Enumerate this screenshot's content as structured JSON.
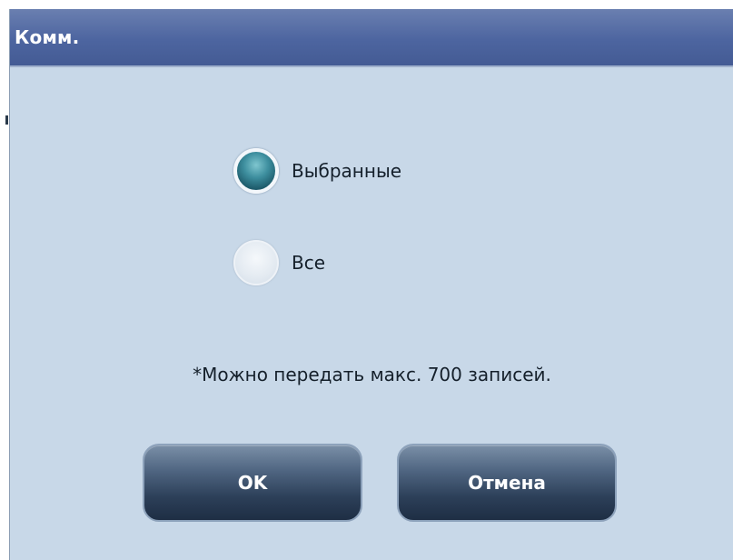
{
  "dialog": {
    "title": "Комм.",
    "options": [
      {
        "label": "Выбранные",
        "selected": true
      },
      {
        "label": "Все",
        "selected": false
      }
    ],
    "note": "*Можно передать макс. 700 записей.",
    "buttons": {
      "ok_label": "OK",
      "cancel_label": "Отмена"
    }
  },
  "colors": {
    "titlebar": "#4d65a0",
    "background": "#c8d8e8",
    "button": "#2c3f58",
    "radio_selected": "#3d8e9e"
  }
}
